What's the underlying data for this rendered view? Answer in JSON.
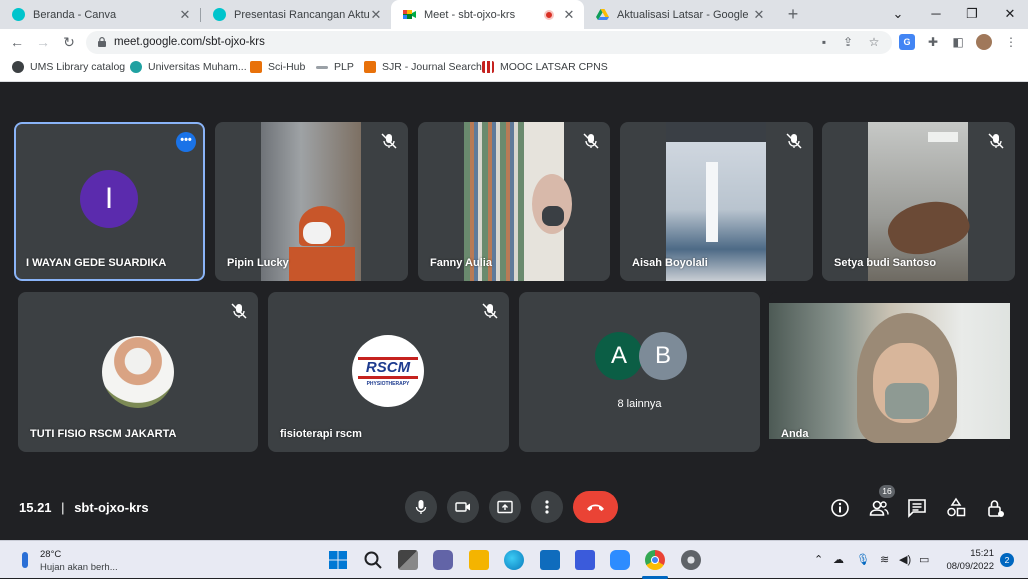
{
  "browser": {
    "tabs": [
      {
        "title": "Beranda - Canva",
        "favicon_color": "#00c4cc"
      },
      {
        "title": "Presentasi Rancangan Aktualisasi",
        "favicon_color": "#00c4cc"
      },
      {
        "title": "Meet - sbt-ojxo-krs",
        "favicon_color": "#00832d"
      },
      {
        "title": "Aktualisasi Latsar - Google Drive",
        "favicon_color": "#fbbc04"
      }
    ],
    "url": "meet.google.com/sbt-ojxo-krs",
    "bookmarks": [
      {
        "label": "UMS Library catalog",
        "color": "#3c4043"
      },
      {
        "label": "Universitas Muham...",
        "color": "#20a1a1"
      },
      {
        "label": "Sci-Hub",
        "color": "#e8710a"
      },
      {
        "label": "PLP",
        "color": "#9aa0a6"
      },
      {
        "label": "SJR - Journal Search",
        "color": "#e8710a"
      },
      {
        "label": "MOOC LATSAR CPNS",
        "color": "#c5221f"
      }
    ]
  },
  "meet": {
    "participants_row1": [
      {
        "name": "I WAYAN GEDE SUARDIKA",
        "initial": "I",
        "avatar_color": "#5b2bad",
        "muted": false,
        "highlighted": true
      },
      {
        "name": "Pipin Lucky",
        "muted": true
      },
      {
        "name": "Fanny Aulia",
        "muted": true
      },
      {
        "name": "Aisah Boyolali",
        "muted": true
      },
      {
        "name": "Setya budi Santoso",
        "muted": true
      }
    ],
    "participants_row2": [
      {
        "name": "TUTI FISIO RSCM JAKARTA",
        "muted": true
      },
      {
        "name": "fisioterapi rscm",
        "muted": true,
        "logo_text": "RSCM",
        "logo_sub": "PHYSIOTHERAPY"
      },
      {
        "name": "8 lainnya",
        "avatars": [
          {
            "initial": "A",
            "color": "#0b5e45"
          },
          {
            "initial": "B",
            "color": "#7d8b98"
          }
        ]
      },
      {
        "name": "Anda"
      }
    ],
    "time": "15.21",
    "separator": "|",
    "meeting_code": "sbt-ojxo-krs",
    "people_count": "16"
  },
  "taskbar": {
    "weather_temp": "28°C",
    "weather_desc": "Hujan akan berh...",
    "clock_time": "15:21",
    "clock_date": "08/09/2022",
    "notification_count": "2"
  }
}
